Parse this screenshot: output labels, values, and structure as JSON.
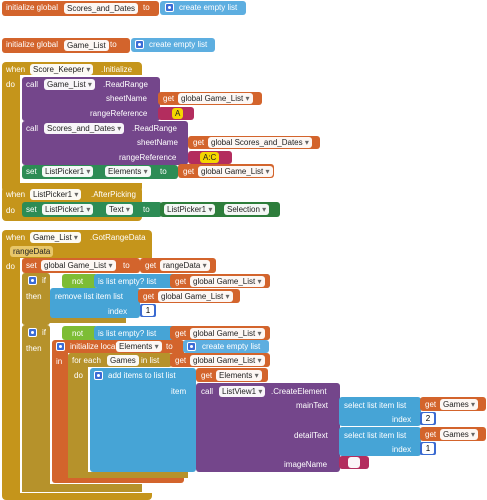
{
  "block1": {
    "prefix": "initialize global",
    "name": "Scores_and_Dates",
    "to": "to",
    "value": "create empty list"
  },
  "block2": {
    "prefix": "initialize global",
    "name": "Game_List",
    "to": "to",
    "value": "create empty list"
  },
  "block3": {
    "when": "when",
    "component": "Score_Keeper",
    "event": ".Initialize",
    "do": "do",
    "call1": {
      "call": "call",
      "component": "Game_List",
      "method": ".ReadRange",
      "arg1": "sheetName",
      "get": "get",
      "var1": "global Game_List",
      "arg2": "rangeReference",
      "text": "A"
    },
    "call2": {
      "call": "call",
      "component": "Scores_and_Dates",
      "method": ".ReadRange",
      "arg1": "sheetName",
      "get": "get",
      "var1": "global Scores_and_Dates",
      "arg2": "rangeReference",
      "text": "A:C"
    },
    "set": {
      "set": "set",
      "component": "ListPicker1",
      "prop": "Elements",
      "to": "to",
      "get": "get",
      "var": "global Game_List"
    }
  },
  "block4": {
    "when": "when",
    "component": "ListPicker1",
    "event": ".AfterPicking",
    "do": "do",
    "set": {
      "set": "set",
      "component": "ListPicker1",
      "prop": "Text",
      "to": "to",
      "comp2": "ListPicker1",
      "prop2": "Selection"
    }
  },
  "block5": {
    "when": "when",
    "component": "Game_List",
    "event": ".GotRangeData",
    "param": "rangeData",
    "do": "do",
    "set": {
      "set": "set",
      "var": "global Game_List",
      "to": "to",
      "get": "get",
      "val": "rangeData"
    },
    "if1": {
      "if": "if",
      "not": "not",
      "empty": "is list empty?  list",
      "get": "get",
      "var": "global Game_List",
      "then": "then",
      "remove": "remove list item  list",
      "get2": "get",
      "var2": "global Game_List",
      "index": "index",
      "num": "1"
    },
    "if2": {
      "if": "if",
      "not": "not",
      "empty": "is list empty?  list",
      "get": "get",
      "var": "global Game_List",
      "then": "then",
      "init": "initialize local",
      "local": "Elements",
      "to": "to",
      "create": "create empty list",
      "in": "in",
      "foreach": "for each",
      "item": "Games",
      "inlist": "in list",
      "get3": "get",
      "var3": "global Game_List",
      "do": "do",
      "add": "add items to list  list",
      "get4": "get",
      "var4": "Elements",
      "itemlbl": "item",
      "call": "call",
      "comp": "ListView1",
      "method": ".CreateElement",
      "mainText": "mainText",
      "detailText": "detailText",
      "imageName": "imageName",
      "select": "select list item  list",
      "get5": "get",
      "var5": "Games",
      "index": "index",
      "n2": "2",
      "n1": "1"
    }
  }
}
